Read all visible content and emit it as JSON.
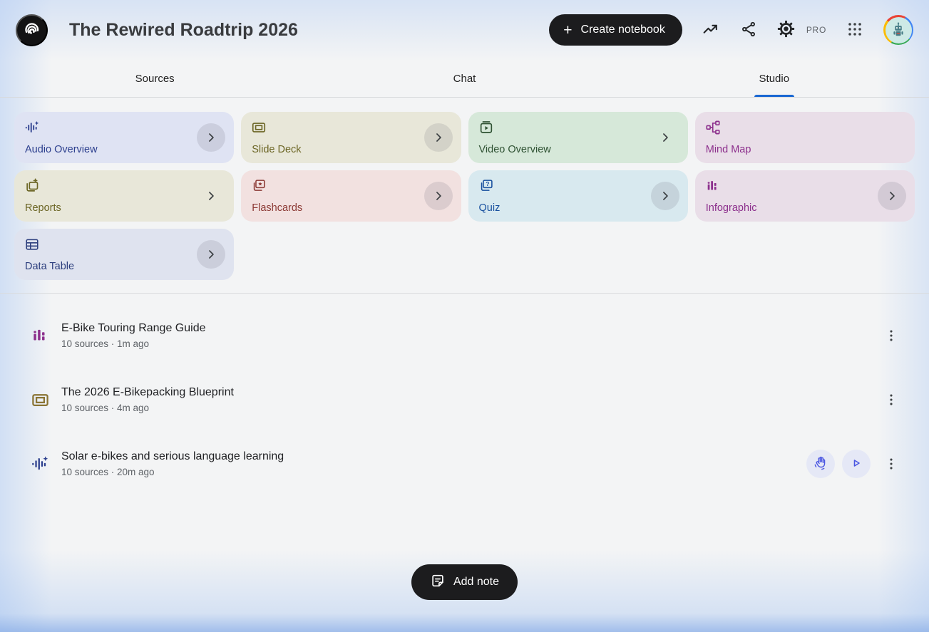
{
  "header": {
    "title": "The Rewired Roadtrip 2026",
    "create_button_label": "Create notebook",
    "pro_label": "PRO"
  },
  "tabs": [
    {
      "label": "Sources",
      "active": false
    },
    {
      "label": "Chat",
      "active": false
    },
    {
      "label": "Studio",
      "active": true
    }
  ],
  "studio_cards": [
    {
      "label": "Audio Overview",
      "icon": "audio-waveform-sparkle-icon",
      "bg": "#dfe3f3",
      "fg": "#2c3f8e",
      "chevron": "circle"
    },
    {
      "label": "Slide Deck",
      "icon": "slide-deck-icon",
      "bg": "#e8e7d9",
      "fg": "#6b6524",
      "chevron": "circle"
    },
    {
      "label": "Video Overview",
      "icon": "video-overview-icon",
      "bg": "#d6e8d9",
      "fg": "#2f5233",
      "chevron": "plain"
    },
    {
      "label": "Mind Map",
      "icon": "mind-map-icon",
      "bg": "#e9dee8",
      "fg": "#8c2f8c",
      "chevron": "none"
    },
    {
      "label": "Reports",
      "icon": "reports-icon",
      "bg": "#e8e7d9",
      "fg": "#6b6524",
      "chevron": "plain"
    },
    {
      "label": "Flashcards",
      "icon": "flashcards-icon",
      "bg": "#f2e1e0",
      "fg": "#8c3a35",
      "chevron": "circle"
    },
    {
      "label": "Quiz",
      "icon": "quiz-icon",
      "bg": "#d8e9ef",
      "fg": "#174f9e",
      "chevron": "circle"
    },
    {
      "label": "Infographic",
      "icon": "infographic-icon",
      "bg": "#e9dee8",
      "fg": "#8c2f8c",
      "chevron": "circle"
    },
    {
      "label": "Data Table",
      "icon": "data-table-icon",
      "bg": "#dfe3ef",
      "fg": "#2c3e7d",
      "chevron": "circle"
    }
  ],
  "artifacts": [
    {
      "title": "E-Bike Touring Range Guide",
      "meta": "10 sources · 1m ago",
      "icon": "infographic-icon",
      "icon_color": "#8c2f8c",
      "actions": [
        "more"
      ]
    },
    {
      "title": "The 2026 E-Bikepacking Blueprint",
      "meta": "10 sources · 4m ago",
      "icon": "slide-deck-icon",
      "icon_color": "#8a7434",
      "actions": [
        "more"
      ]
    },
    {
      "title": "Solar e-bikes and serious language learning",
      "meta": "10 sources · 20m ago",
      "icon": "audio-waveform-sparkle-icon",
      "icon_color": "#2c3f8e",
      "actions": [
        "interactive-mode",
        "play",
        "more"
      ]
    }
  ],
  "footer": {
    "add_note_label": "Add note"
  },
  "colors": {
    "accent_blue": "#1967d2",
    "button_black": "#1c1c1e",
    "action_icon_blue": "#4a56e2",
    "action_circle_bg": "#e5e8f6",
    "edge_glow_blue": "#a9c6ee"
  }
}
